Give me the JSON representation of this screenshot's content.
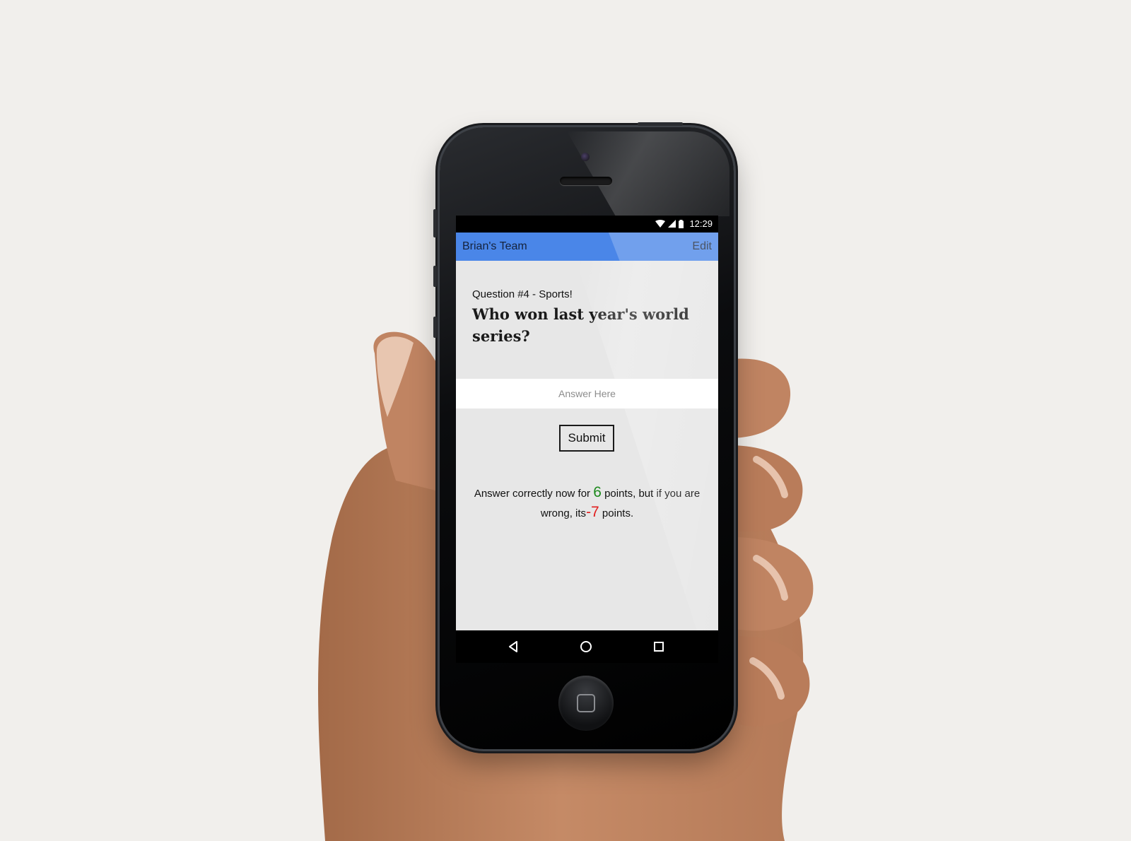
{
  "status_bar": {
    "time": "12:29"
  },
  "app_bar": {
    "title": "Brian's Team",
    "edit_label": "Edit"
  },
  "question": {
    "label": "Question #4 - Sports!",
    "text": "Who won last year's world series?"
  },
  "answer": {
    "placeholder": "Answer Here"
  },
  "submit_label": "Submit",
  "scoring": {
    "prefix": "Answer correctly now for",
    "correct_points": "6",
    "middle": "points, but if you are wrong, its",
    "wrong_points": "-7",
    "suffix": "points."
  },
  "colors": {
    "app_bar": "#4a86e8",
    "positive": "#1d8a1d",
    "negative": "#e21e1e"
  },
  "icons": [
    "wifi-icon",
    "signal-icon",
    "battery-icon",
    "back-icon",
    "home-icon",
    "recents-icon"
  ]
}
